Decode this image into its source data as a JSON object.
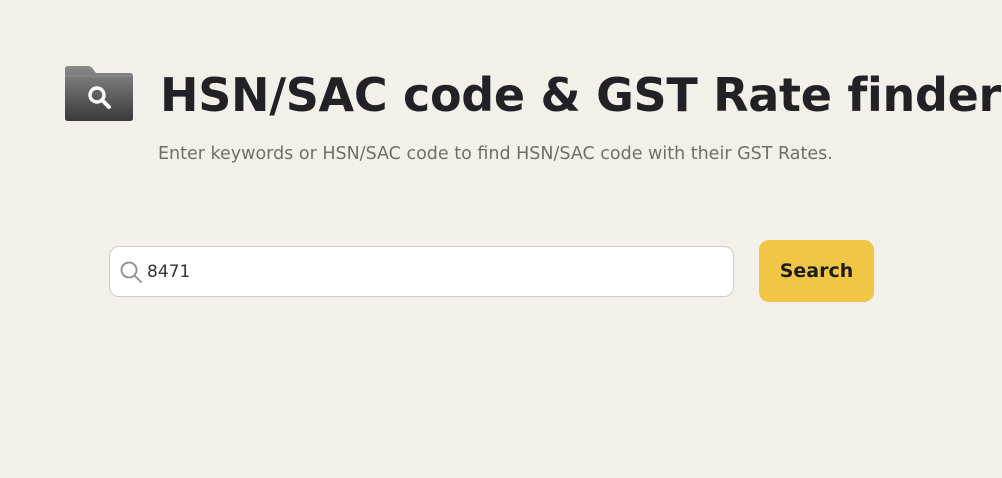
{
  "header": {
    "icon": "folder-search-icon",
    "title": "HSN/SAC code & GST Rate finder",
    "subtitle": "Enter keywords or HSN/SAC code to find HSN/SAC code with their GST Rates."
  },
  "search": {
    "icon": "search-icon",
    "value": "8471",
    "button_label": "Search"
  },
  "colors": {
    "background": "#f3f0e9",
    "button": "#f1c644",
    "title": "#222226",
    "subtitle": "#6f6e6c"
  }
}
